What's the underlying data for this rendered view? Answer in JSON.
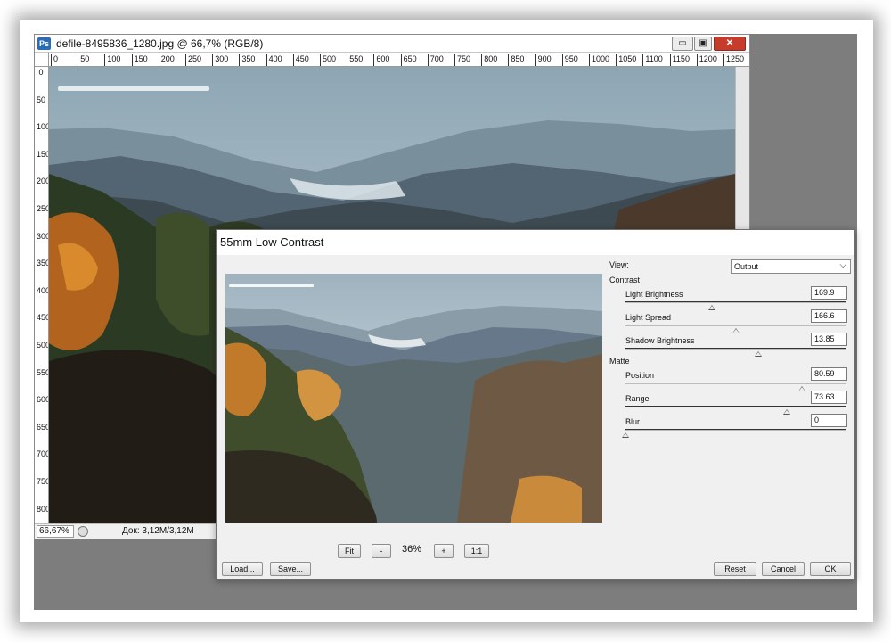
{
  "ps_window": {
    "title": "defile-8495836_1280.jpg @ 66,7% (RGB/8)",
    "logo": "Ps",
    "buttons": {
      "minimize": "▭",
      "restore": "▣",
      "close": "✕"
    },
    "ruler_h": [
      "0",
      "50",
      "100",
      "150",
      "200",
      "250",
      "300",
      "350",
      "400",
      "450",
      "500",
      "550",
      "600",
      "650",
      "700",
      "750",
      "800",
      "850",
      "900",
      "950",
      "1000",
      "1050",
      "1100",
      "1150",
      "1200",
      "1250"
    ],
    "ruler_v": [
      "0",
      "50",
      "100",
      "150",
      "200",
      "250",
      "300",
      "350",
      "400",
      "450",
      "500",
      "550",
      "600",
      "650",
      "700",
      "750",
      "800"
    ],
    "status": {
      "zoom": "66,67%",
      "doc": "Док: 3,12M/3,12M"
    }
  },
  "dialog": {
    "title": "55mm Low Contrast",
    "view_label": "View:",
    "view_value": "Output",
    "contrast_label": "Contrast",
    "matte_label": "Matte",
    "params": [
      {
        "label": "Light Brightness",
        "value": "169.9",
        "level": 0.39
      },
      {
        "label": "Light Spread",
        "value": "166.6",
        "level": 0.5
      },
      {
        "label": "Shadow Brightness",
        "value": "13.85",
        "level": 0.6
      },
      {
        "label": "Position",
        "value": "80.59",
        "level": 0.8
      },
      {
        "label": "Range",
        "value": "73.63",
        "level": 0.73
      },
      {
        "label": "Blur",
        "value": "0",
        "level": 0.0
      }
    ],
    "zoom": {
      "fit": "Fit",
      "minus": "-",
      "percent": "36%",
      "plus": "+",
      "one_to_one": "1:1"
    },
    "buttons": {
      "load": "Load...",
      "save": "Save...",
      "reset": "Reset",
      "cancel": "Cancel",
      "ok": "OK"
    }
  }
}
